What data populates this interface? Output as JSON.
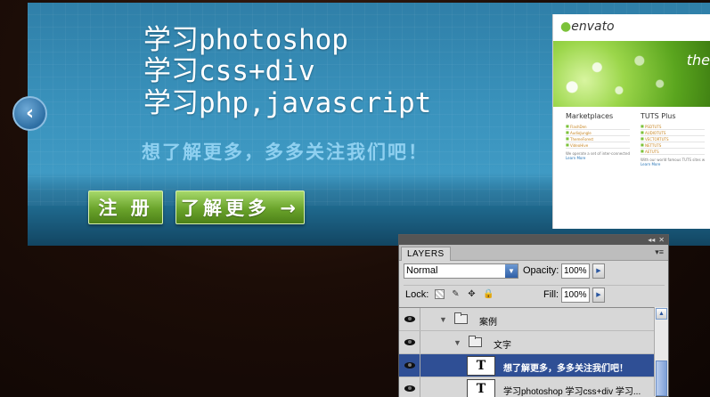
{
  "banner": {
    "headline_lines": [
      "学习photoshop",
      "学习css+div",
      "学习php,javascript"
    ],
    "tagline": "想了解更多，多多关注我们吧！",
    "register_button": "注 册",
    "learn_more_button": "了解更多 →",
    "prev_arrow": "‹"
  },
  "preview": {
    "logo": "envato",
    "hero_text": "the",
    "col1_title": "Marketplaces",
    "col1_items": [
      "FlashDen",
      "AudioJungle",
      "ThemeForest",
      "VideoHive"
    ],
    "col1_para": "We operate a set of inter-connected marketplaces for digital goods that allow anyone to buy or sell Flash, music loops, sounds, video effects, stock footage, site templates and CMS themes.",
    "col1_link": "Learn More",
    "col2_title": "TUTS Plus",
    "col2_items": [
      "PSDTUTS",
      "AUDIOTUTS",
      "VECTORTUTS",
      "NETTUTS",
      "AETUTS"
    ],
    "col2_para": "With our world famous TUTS sites we offer free training and tutorials on Photoshop, web development, audio production and more.",
    "col2_link": "Learn More"
  },
  "layers_panel": {
    "tab_title": "LAYERS",
    "topbar_icons": [
      "◂◂",
      "✕"
    ],
    "menu_icon": "▾≡",
    "blend_mode": "Normal",
    "opacity_label": "Opacity:",
    "opacity_value": "100%",
    "lock_label": "Lock:",
    "fill_label": "Fill:",
    "fill_value": "100%",
    "layers": [
      {
        "name": "案例",
        "type": "group"
      },
      {
        "name": "文字",
        "type": "group"
      },
      {
        "name": "想了解更多，多多关注我们吧！",
        "type": "text",
        "selected": true
      },
      {
        "name": "学习photoshop 学习css+div 学习...",
        "type": "text"
      }
    ]
  },
  "colors": {
    "banner_blue": "#3a93bd",
    "button_green": "#6aa32b",
    "tagline_blue": "#8fd0f0",
    "selection_blue": "#2f4f95"
  }
}
